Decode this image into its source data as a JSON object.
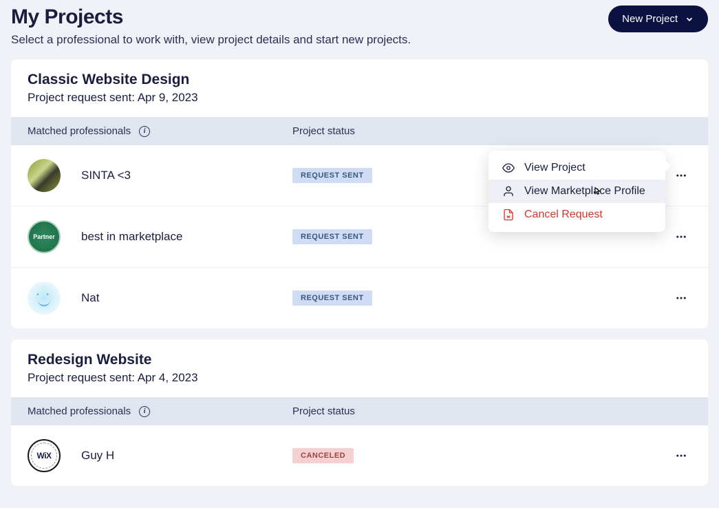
{
  "header": {
    "title": "My Projects",
    "subtitle": "Select a professional to work with, view project details and start new projects.",
    "newProjectLabel": "New Project"
  },
  "columnHeaders": {
    "matched": "Matched professionals",
    "status": "Project status"
  },
  "statusLabels": {
    "requestSent": "REQUEST SENT",
    "canceled": "CANCELED"
  },
  "dropdown": {
    "viewProject": "View Project",
    "viewProfile": "View Marketplace Profile",
    "cancel": "Cancel Request"
  },
  "projects": [
    {
      "name": "Classic Website Design",
      "sent": "Project request sent: Apr 9, 2023",
      "pros": [
        {
          "name": "SINTA <3",
          "statusKey": "requestSent",
          "avatar": "sinta",
          "avatarLabel": ""
        },
        {
          "name": "best in marketplace",
          "statusKey": "requestSent",
          "avatar": "partner",
          "avatarLabel": "Partner"
        },
        {
          "name": "Nat",
          "statusKey": "requestSent",
          "avatar": "nat",
          "avatarLabel": ""
        }
      ]
    },
    {
      "name": "Redesign Website",
      "sent": "Project request sent: Apr 4, 2023",
      "pros": [
        {
          "name": "Guy H",
          "statusKey": "canceled",
          "avatar": "wix",
          "avatarLabel": "WiX"
        }
      ]
    }
  ]
}
